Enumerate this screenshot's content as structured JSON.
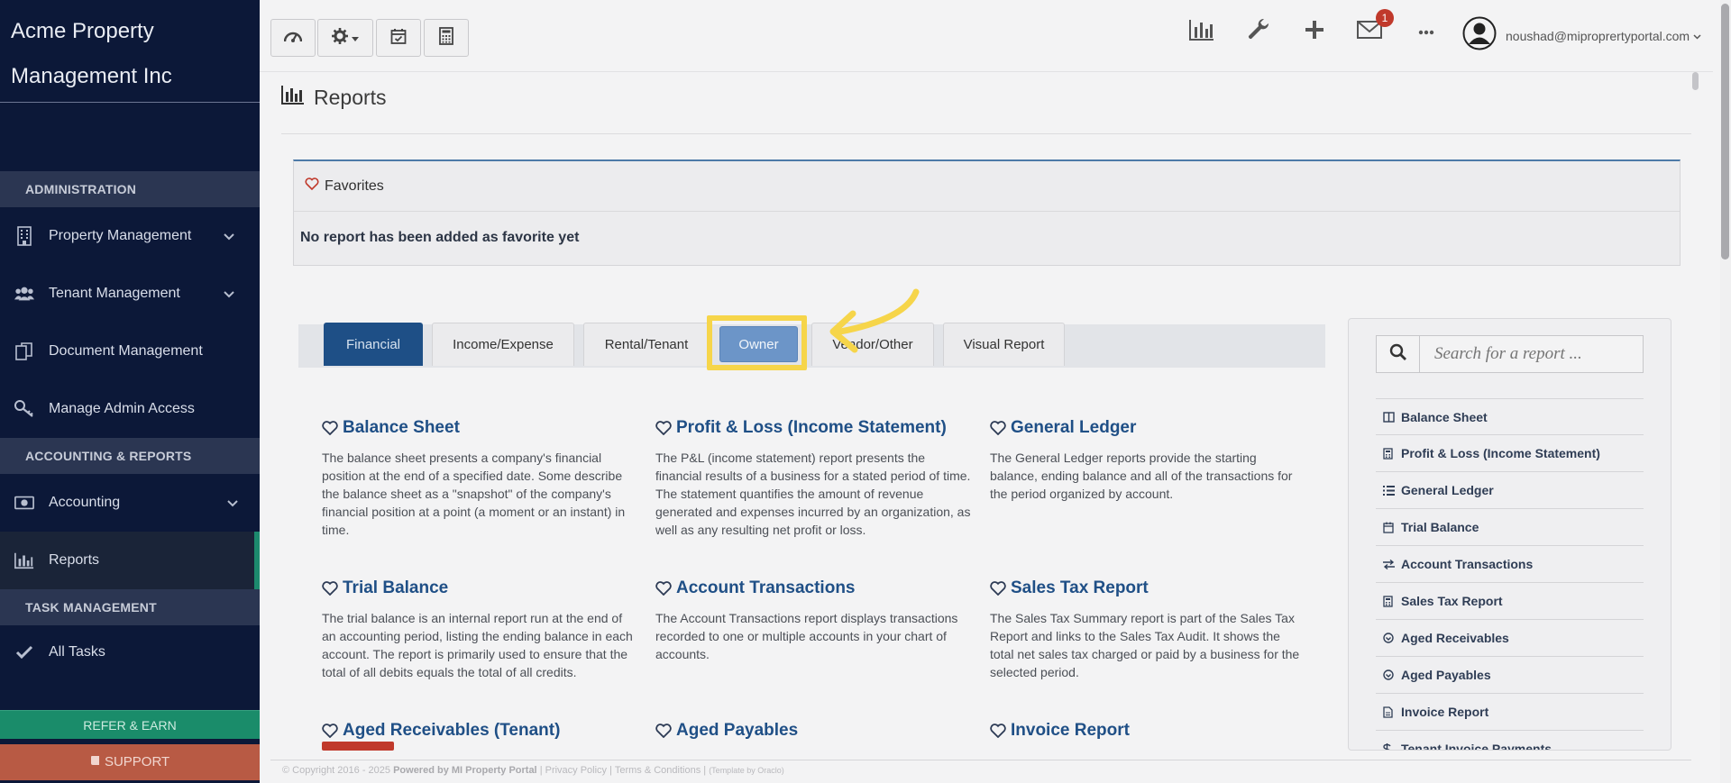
{
  "brand": {
    "line1": "Acme Property",
    "line2": "Management Inc"
  },
  "sidebar": {
    "sections": [
      "ADMINISTRATION",
      "ACCOUNTING & REPORTS",
      "TASK MANAGEMENT"
    ],
    "items": [
      {
        "label": "Property Management",
        "icon": "building-icon"
      },
      {
        "label": "Tenant Management",
        "icon": "users-icon"
      },
      {
        "label": "Document Management",
        "icon": "documents-icon"
      },
      {
        "label": "Manage Admin Access",
        "icon": "key-icon"
      },
      {
        "label": "Accounting",
        "icon": "money-icon"
      },
      {
        "label": "Reports",
        "icon": "bar-chart-icon"
      },
      {
        "label": "All Tasks",
        "icon": "check-icon"
      }
    ],
    "refer_label": "REFER & EARN",
    "support_label": "SUPPORT"
  },
  "topbar": {
    "mail_count": "1",
    "user_email": "noushad@miproprertyportal.com"
  },
  "page": {
    "title": "Reports"
  },
  "favorites": {
    "title": "Favorites",
    "empty_text": "No report has been added as favorite yet"
  },
  "tabs": [
    {
      "label": "Financial"
    },
    {
      "label": "Income/Expense"
    },
    {
      "label": "Rental/Tenant"
    },
    {
      "label": "Owner"
    },
    {
      "label": "Vendor/Other"
    },
    {
      "label": "Visual Report"
    }
  ],
  "reports": [
    {
      "title": "Balance Sheet",
      "desc": "The balance sheet presents a company's financial position at the end of a specified date. Some describe the balance sheet as a \"snapshot\" of the company's financial position at a point (a moment or an instant) in time."
    },
    {
      "title": "Profit & Loss (Income Statement)",
      "desc": "The P&L (income statement) report presents the financial results of a business for a stated period of time. The statement quantifies the amount of revenue generated and expenses incurred by an organization, as well as any resulting net profit or loss."
    },
    {
      "title": "General Ledger",
      "desc": "The General Ledger reports provide the starting balance, ending balance and all of the transactions for the period organized by account."
    },
    {
      "title": "Trial Balance",
      "desc": "The trial balance is an internal report run at the end of an accounting period, listing the ending balance in each account. The report is primarily used to ensure that the total of all debits equals the total of all credits."
    },
    {
      "title": "Account Transactions",
      "desc": "The Account Transactions report displays transactions recorded to one or multiple accounts in your chart of accounts."
    },
    {
      "title": "Sales Tax Report",
      "desc": "The Sales Tax Summary report is part of the Sales Tax Report and links to the Sales Tax Audit. It shows the total net sales tax charged or paid by a business for the selected period."
    },
    {
      "title": "Aged Receivables (Tenant)",
      "desc": ""
    },
    {
      "title": "Aged Payables",
      "desc": ""
    },
    {
      "title": "Invoice Report",
      "desc": ""
    }
  ],
  "search": {
    "placeholder": "Search for a report ..."
  },
  "quick_list": [
    {
      "label": "Balance Sheet",
      "icon": "columns-icon"
    },
    {
      "label": "Profit & Loss (Income Statement)",
      "icon": "calculator-icon"
    },
    {
      "label": "General Ledger",
      "icon": "list-icon"
    },
    {
      "label": "Trial Balance",
      "icon": "calendar-icon"
    },
    {
      "label": "Account Transactions",
      "icon": "exchange-icon"
    },
    {
      "label": "Sales Tax Report",
      "icon": "calculator-icon"
    },
    {
      "label": "Aged Receivables",
      "icon": "arrow-circle-icon"
    },
    {
      "label": "Aged Payables",
      "icon": "arrow-circle-icon"
    },
    {
      "label": "Invoice Report",
      "icon": "file-icon"
    },
    {
      "label": "Tenant Invoice Payments",
      "icon": "dollar-icon"
    }
  ],
  "footer": {
    "copyright": "© Copyright 2016 - 2025",
    "powered": "Powered by MI Property Portal",
    "links": "| Privacy Policy | Terms & Conditions |",
    "template": "(Template by Oraclo)"
  },
  "colors": {
    "sidebar": "#0c1838",
    "accent": "#1e4f86",
    "highlight": "#f6d54a"
  }
}
